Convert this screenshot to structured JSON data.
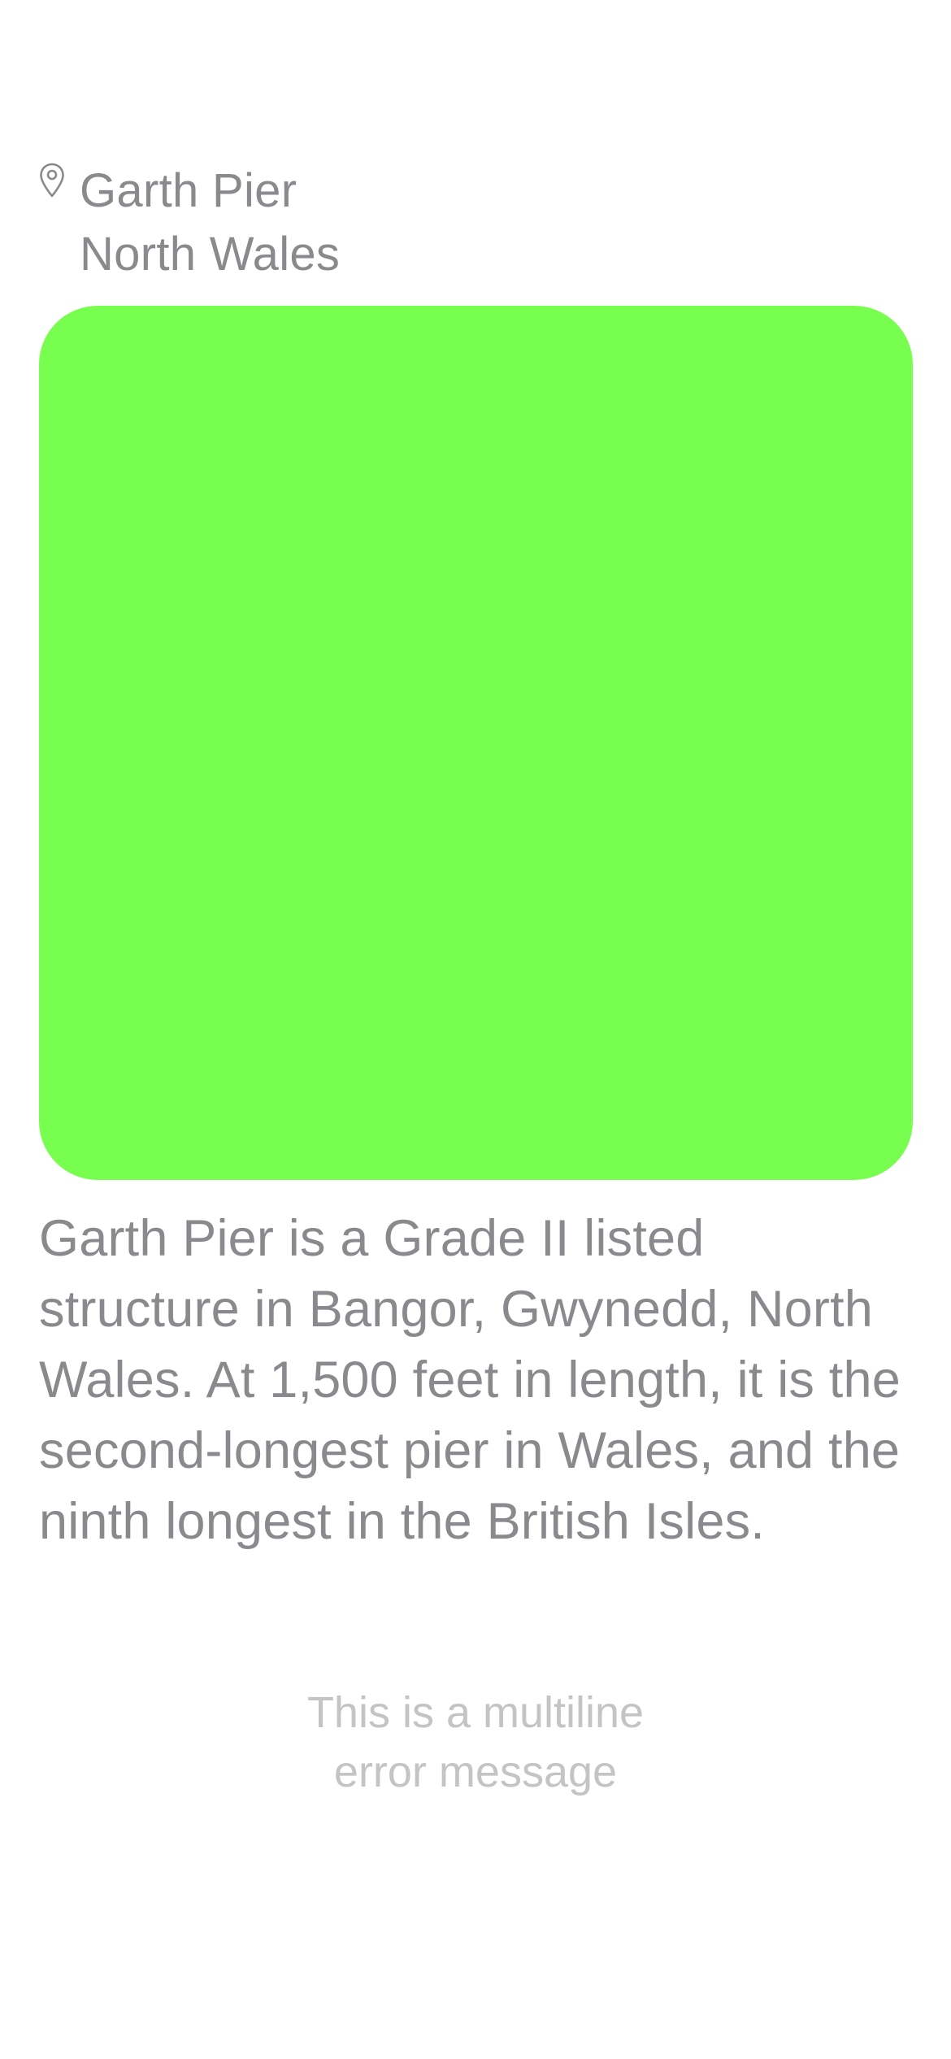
{
  "location": {
    "icon": "map-pin-icon",
    "name": "Garth Pier",
    "region": "North Wales"
  },
  "image": {
    "color": "#78fe4e"
  },
  "description": "Garth Pier is a Grade II listed structure in Bangor, Gwynedd, North Wales. At 1,500 feet in length, it is the second-longest pier in Wales, and the ninth longest in the British Isles.",
  "error": {
    "line1": "This is a multiline",
    "line2": "error message"
  },
  "colors": {
    "text_primary": "#8a8a8e",
    "text_secondary": "#c4c4c6",
    "background": "#ffffff"
  }
}
